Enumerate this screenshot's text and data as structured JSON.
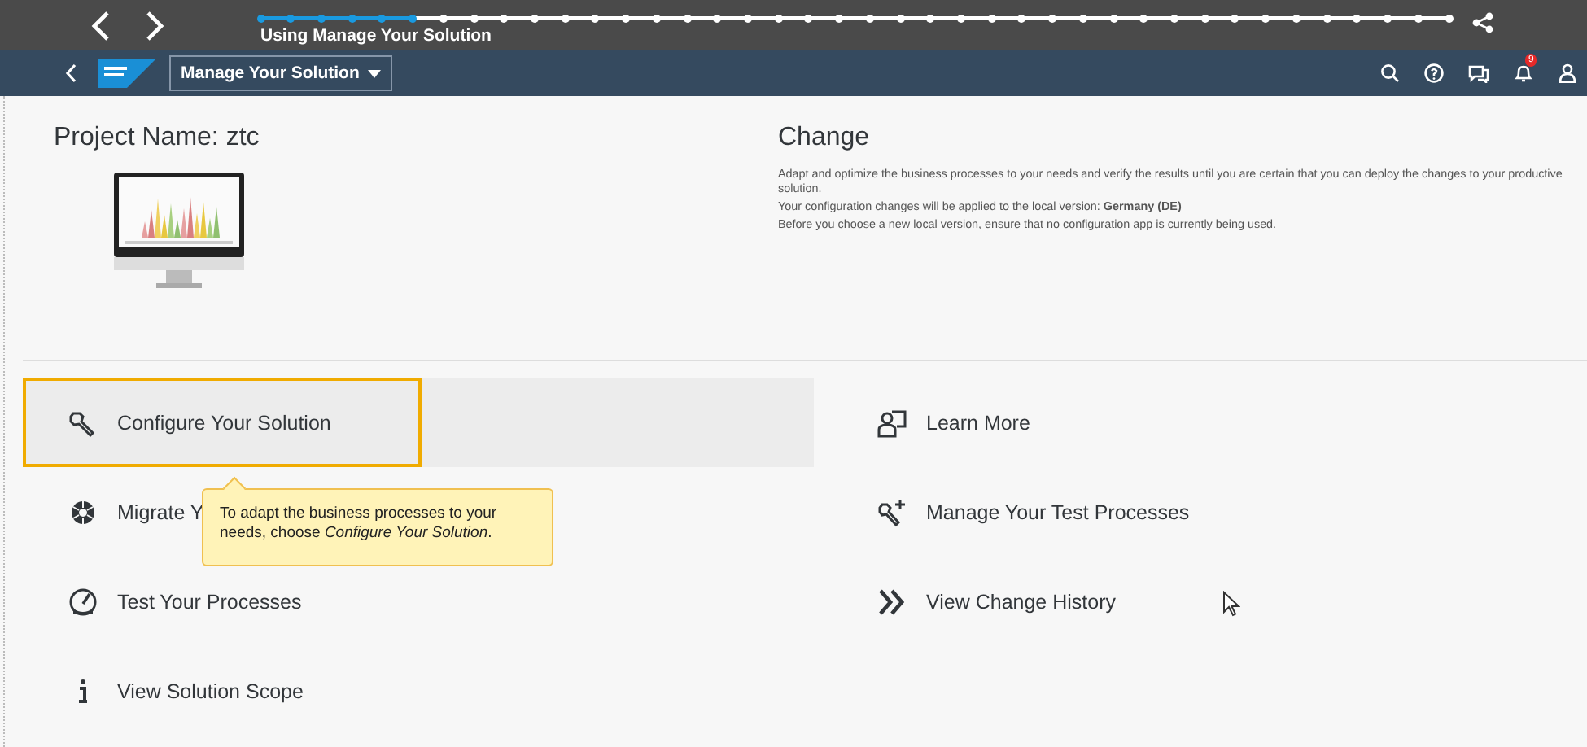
{
  "tour_bar": {
    "title": "Using Manage Your Solution",
    "level": 0.13
  },
  "shell_bar": {
    "app_title": "Manage Your Solution",
    "notification_count": "9"
  },
  "project": {
    "label": "Project Name: ztc"
  },
  "change": {
    "title": "Change",
    "description": "Adapt and optimize the business processes to your needs and verify the results until you are certain that you can deploy the changes to your productive solution.",
    "version_text": "Your configuration changes will be applied to the local version:  **Germany (DE)**",
    "note": "Before you choose a new local version, ensure that no configuration app is currently being used."
  },
  "tiles_left": [
    {
      "label": "Configure Your Solution",
      "highlighted": true
    },
    {
      "label": "Migrate Y",
      "highlighted": false
    },
    {
      "label": "Test Your Processes",
      "highlighted": false
    },
    {
      "label": "View Solution Scope",
      "highlighted": false
    }
  ],
  "tiles_right": [
    {
      "label": "Learn More"
    },
    {
      "label": "Manage Your Test Processes"
    },
    {
      "label": "View Change History"
    }
  ],
  "tooltip": {
    "text": "To adapt the business processes to your needs, choose *Configure Your Solution*."
  }
}
